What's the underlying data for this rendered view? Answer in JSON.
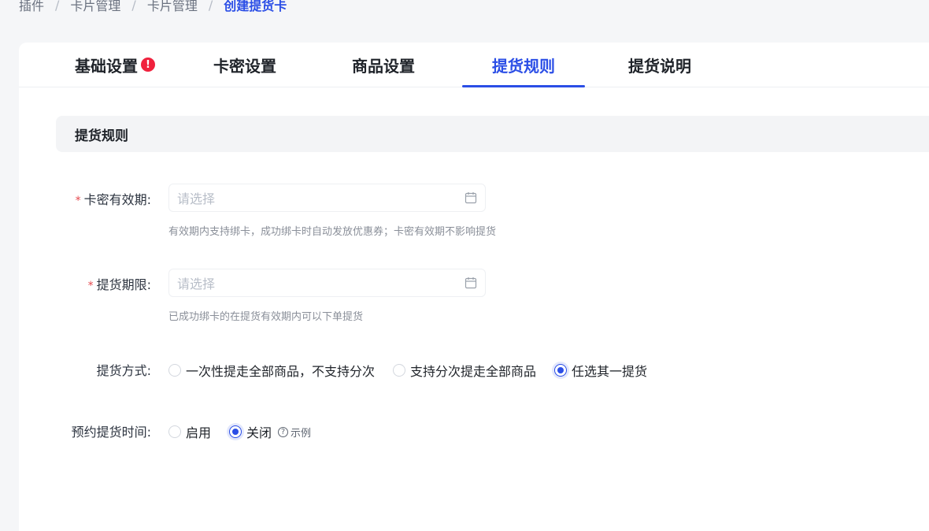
{
  "breadcrumb": {
    "items": [
      "插件",
      "卡片管理",
      "卡片管理"
    ],
    "current": "创建提货卡",
    "separator": "/"
  },
  "tabs": [
    {
      "label": "基础设置",
      "alert": "!"
    },
    {
      "label": "卡密设置"
    },
    {
      "label": "商品设置"
    },
    {
      "label": "提货规则",
      "active": true
    },
    {
      "label": "提货说明"
    }
  ],
  "section": {
    "title": "提货规则"
  },
  "form": {
    "card_validity": {
      "required_mark": "*",
      "label": "卡密有效期:",
      "placeholder": "请选择",
      "hint": "有效期内支持绑卡，成功绑卡时自动发放优惠券；卡密有效期不影响提货"
    },
    "pickup_period": {
      "required_mark": "*",
      "label": "提货期限:",
      "placeholder": "请选择",
      "hint": "已成功绑卡的在提货有效期内可以下单提货"
    },
    "pickup_method": {
      "label": "提货方式:",
      "options": [
        "一次性提走全部商品，不支持分次",
        "支持分次提走全部商品",
        "任选其一提货"
      ],
      "selected": "任选其一提货"
    },
    "reservation_time": {
      "label": "预约提货时间:",
      "options": [
        "启用",
        "关闭"
      ],
      "selected": "关闭",
      "help_icon": "?",
      "help_label": "示例"
    }
  },
  "colors": {
    "accent": "#2b4ee6",
    "alert": "#f0213d",
    "required": "#e5484d"
  }
}
